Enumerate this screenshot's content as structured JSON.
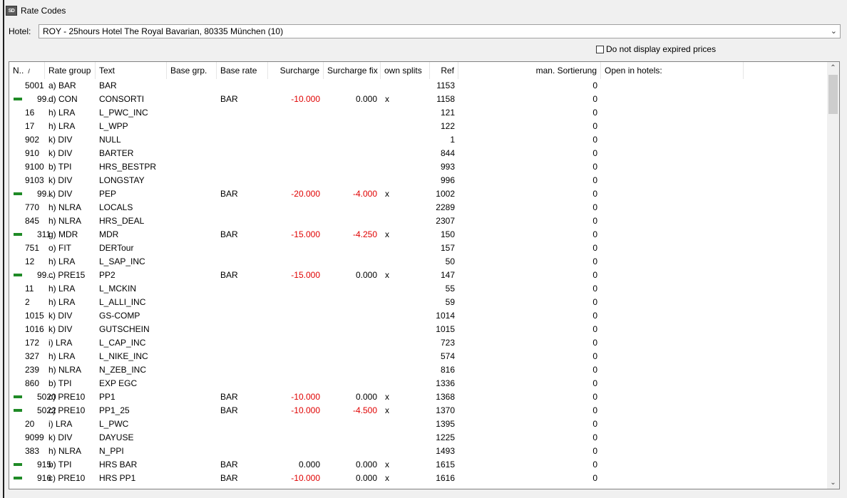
{
  "window": {
    "title": "Rate Codes",
    "icon_text": "SD"
  },
  "hotel": {
    "label": "Hotel:",
    "selected": "ROY - 25hours Hotel The Royal Bavarian, 80335 München  (10)"
  },
  "filter": {
    "expired_label": "Do not display expired prices",
    "expired_checked": false
  },
  "table": {
    "headers": {
      "nr": "N..",
      "rate_group": "Rate group",
      "text": "Text",
      "base_grp": "Base grp.",
      "base_rate": "Base rate",
      "surcharge": "Surcharge",
      "surcharge_fix": "Surcharge fix",
      "own_splits": "own splits",
      "ref": "Ref",
      "man_sort": "man. Sortierung",
      "open_in_hotels": "Open in hotels:"
    },
    "sort_indicator": "/",
    "rows": [
      {
        "flag": false,
        "nr": "5001",
        "rg": "a) BAR",
        "text": "BAR",
        "base": "",
        "sur": "",
        "fix": "",
        "own": "",
        "ref": "1153",
        "sort": "0"
      },
      {
        "flag": true,
        "nr": "99...",
        "rg": "d) CON",
        "text": "CONSORTI",
        "base": "BAR",
        "sur": "-10.000",
        "fix": "0.000",
        "own": "x",
        "ref": "1158",
        "sort": "0"
      },
      {
        "flag": false,
        "nr": "16",
        "rg": "h)  LRA",
        "text": "L_PWC_INC",
        "base": "",
        "sur": "",
        "fix": "",
        "own": "",
        "ref": "121",
        "sort": "0"
      },
      {
        "flag": false,
        "nr": "17",
        "rg": "h)  LRA",
        "text": "L_WPP",
        "base": "",
        "sur": "",
        "fix": "",
        "own": "",
        "ref": "122",
        "sort": "0"
      },
      {
        "flag": false,
        "nr": "902",
        "rg": "k) DIV",
        "text": "NULL",
        "base": "",
        "sur": "",
        "fix": "",
        "own": "",
        "ref": "1",
        "sort": "0"
      },
      {
        "flag": false,
        "nr": "910",
        "rg": "k) DIV",
        "text": "BARTER",
        "base": "",
        "sur": "",
        "fix": "",
        "own": "",
        "ref": "844",
        "sort": "0"
      },
      {
        "flag": false,
        "nr": "9100",
        "rg": "b) TPI",
        "text": "HRS_BESTPR",
        "base": "",
        "sur": "",
        "fix": "",
        "own": "",
        "ref": "993",
        "sort": "0"
      },
      {
        "flag": false,
        "nr": "9103",
        "rg": "k) DIV",
        "text": "LONGSTAY",
        "base": "",
        "sur": "",
        "fix": "",
        "own": "",
        "ref": "996",
        "sort": "0"
      },
      {
        "flag": true,
        "nr": "99...",
        "rg": "k) DIV",
        "text": "PEP",
        "base": "BAR",
        "sur": "-20.000",
        "fix": "-4.000",
        "own": "x",
        "ref": "1002",
        "sort": "0"
      },
      {
        "flag": false,
        "nr": "770",
        "rg": "h) NLRA",
        "text": "LOCALS",
        "base": "",
        "sur": "",
        "fix": "",
        "own": "",
        "ref": "2289",
        "sort": "0"
      },
      {
        "flag": false,
        "nr": "845",
        "rg": "h) NLRA",
        "text": "HRS_DEAL",
        "base": "",
        "sur": "",
        "fix": "",
        "own": "",
        "ref": "2307",
        "sort": "0"
      },
      {
        "flag": true,
        "nr": "311",
        "rg": "g) MDR",
        "text": "MDR",
        "base": "BAR",
        "sur": "-15.000",
        "fix": "-4.250",
        "own": "x",
        "ref": "150",
        "sort": "0"
      },
      {
        "flag": false,
        "nr": "751",
        "rg": "o) FIT",
        "text": "DERTour",
        "base": "",
        "sur": "",
        "fix": "",
        "own": "",
        "ref": "157",
        "sort": "0"
      },
      {
        "flag": false,
        "nr": "12",
        "rg": "h)  LRA",
        "text": "L_SAP_INC",
        "base": "",
        "sur": "",
        "fix": "",
        "own": "",
        "ref": "50",
        "sort": "0"
      },
      {
        "flag": true,
        "nr": "99...",
        "rg": "c) PRE15",
        "text": "PP2",
        "base": "BAR",
        "sur": "-15.000",
        "fix": "0.000",
        "own": "x",
        "ref": "147",
        "sort": "0"
      },
      {
        "flag": false,
        "nr": "11",
        "rg": "h)  LRA",
        "text": "L_MCKIN",
        "base": "",
        "sur": "",
        "fix": "",
        "own": "",
        "ref": "55",
        "sort": "0"
      },
      {
        "flag": false,
        "nr": "2",
        "rg": "h)  LRA",
        "text": "L_ALLI_INC",
        "base": "",
        "sur": "",
        "fix": "",
        "own": "",
        "ref": "59",
        "sort": "0"
      },
      {
        "flag": false,
        "nr": "1015",
        "rg": "k) DIV",
        "text": "GS-COMP",
        "base": "",
        "sur": "",
        "fix": "",
        "own": "",
        "ref": "1014",
        "sort": "0"
      },
      {
        "flag": false,
        "nr": "1016",
        "rg": "k) DIV",
        "text": "GUTSCHEIN",
        "base": "",
        "sur": "",
        "fix": "",
        "own": "",
        "ref": "1015",
        "sort": "0"
      },
      {
        "flag": false,
        "nr": "172",
        "rg": "i)  LRA",
        "text": "L_CAP_INC",
        "base": "",
        "sur": "",
        "fix": "",
        "own": "",
        "ref": "723",
        "sort": "0"
      },
      {
        "flag": false,
        "nr": "327",
        "rg": "h)  LRA",
        "text": "L_NIKE_INC",
        "base": "",
        "sur": "",
        "fix": "",
        "own": "",
        "ref": "574",
        "sort": "0"
      },
      {
        "flag": false,
        "nr": "239",
        "rg": "h) NLRA",
        "text": "N_ZEB_INC",
        "base": "",
        "sur": "",
        "fix": "",
        "own": "",
        "ref": "816",
        "sort": "0"
      },
      {
        "flag": false,
        "nr": "860",
        "rg": "b) TPI",
        "text": "EXP EGC",
        "base": "",
        "sur": "",
        "fix": "",
        "own": "",
        "ref": "1336",
        "sort": "0"
      },
      {
        "flag": true,
        "nr": "5020",
        "rg": "c) PRE10",
        "text": "PP1",
        "base": "BAR",
        "sur": "-10.000",
        "fix": "0.000",
        "own": "x",
        "ref": "1368",
        "sort": "0"
      },
      {
        "flag": true,
        "nr": "5022",
        "rg": "c) PRE10",
        "text": "PP1_25",
        "base": "BAR",
        "sur": "-10.000",
        "fix": "-4.500",
        "own": "x",
        "ref": "1370",
        "sort": "0"
      },
      {
        "flag": false,
        "nr": "20",
        "rg": "i)  LRA",
        "text": "L_PWC",
        "base": "",
        "sur": "",
        "fix": "",
        "own": "",
        "ref": "1395",
        "sort": "0"
      },
      {
        "flag": false,
        "nr": "9099",
        "rg": "k) DIV",
        "text": "DAYUSE",
        "base": "",
        "sur": "",
        "fix": "",
        "own": "",
        "ref": "1225",
        "sort": "0"
      },
      {
        "flag": false,
        "nr": "383",
        "rg": "h) NLRA",
        "text": "N_PPI",
        "base": "",
        "sur": "",
        "fix": "",
        "own": "",
        "ref": "1493",
        "sort": "0"
      },
      {
        "flag": true,
        "nr": "915",
        "rg": "b) TPI",
        "text": "HRS BAR",
        "base": "BAR",
        "sur": "0.000",
        "fix": "0.000",
        "own": "x",
        "ref": "1615",
        "sort": "0"
      },
      {
        "flag": true,
        "nr": "916",
        "rg": "c) PRE10",
        "text": "HRS PP1",
        "base": "BAR",
        "sur": "-10.000",
        "fix": "0.000",
        "own": "x",
        "ref": "1616",
        "sort": "0"
      }
    ]
  },
  "colors": {
    "negative": "#e00000",
    "flag_arrow": "#1f8a26"
  }
}
